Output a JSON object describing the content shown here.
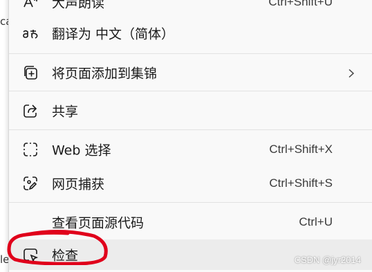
{
  "background_fragments": [
    "ca",
    "le"
  ],
  "menu": {
    "items": [
      {
        "id": "read-aloud",
        "label": "大声朗读",
        "shortcut": "Ctrl+Shift+U",
        "icon": "read-aloud-icon"
      },
      {
        "id": "translate",
        "label": "翻译为 中文（简体）",
        "shortcut": "",
        "icon": "translate-icon"
      },
      {
        "id": "add-collection",
        "label": "将页面添加到集锦",
        "shortcut": "",
        "icon": "collections-add-icon",
        "has_submenu": true
      },
      {
        "id": "share",
        "label": "共享",
        "shortcut": "",
        "icon": "share-icon"
      },
      {
        "id": "web-select",
        "label": "Web 选择",
        "shortcut": "Ctrl+Shift+X",
        "icon": "web-select-icon"
      },
      {
        "id": "web-capture",
        "label": "网页捕获",
        "shortcut": "Ctrl+Shift+S",
        "icon": "web-capture-icon"
      },
      {
        "id": "view-source",
        "label": "查看页面源代码",
        "shortcut": "Ctrl+U",
        "icon": ""
      },
      {
        "id": "inspect",
        "label": "检查",
        "shortcut": "",
        "icon": "inspect-icon",
        "highlighted": true
      }
    ]
  },
  "annotation": {
    "shape": "hand-drawn ellipse",
    "color": "#e0001b"
  },
  "watermark": "CSDN @jyr2014"
}
